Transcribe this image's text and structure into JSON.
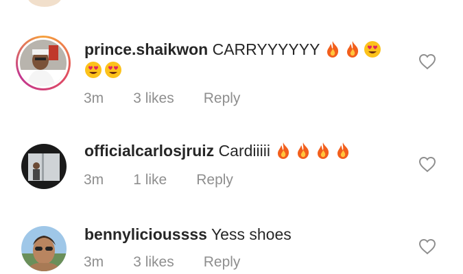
{
  "comments": [
    {
      "username": "prince.shaikwon",
      "text": "CARRYYYYYY",
      "emojis_line1": [
        "fire",
        "fire",
        "heart-eyes"
      ],
      "emojis_line2": [
        "heart-eyes",
        "heart-eyes"
      ],
      "time": "3m",
      "likes": "3 likes",
      "reply": "Reply",
      "has_story_ring": true
    },
    {
      "username": "officialcarlosjruiz",
      "text": "Cardiiiii",
      "emojis_line1": [
        "fire",
        "fire",
        "fire",
        "fire"
      ],
      "time": "3m",
      "likes": "1 like",
      "reply": "Reply",
      "has_story_ring": false
    },
    {
      "username": "bennylicioussss",
      "text": "Yess shoes",
      "time": "3m",
      "likes": "3 likes",
      "reply": "Reply",
      "has_story_ring": false
    }
  ],
  "colors": {
    "username": "#262626",
    "meta": "#8e8e8e",
    "heart_outline": "#8e8e8e"
  },
  "icons": [
    "heart-outline-icon",
    "fire-emoji",
    "heart-eyes-emoji"
  ]
}
